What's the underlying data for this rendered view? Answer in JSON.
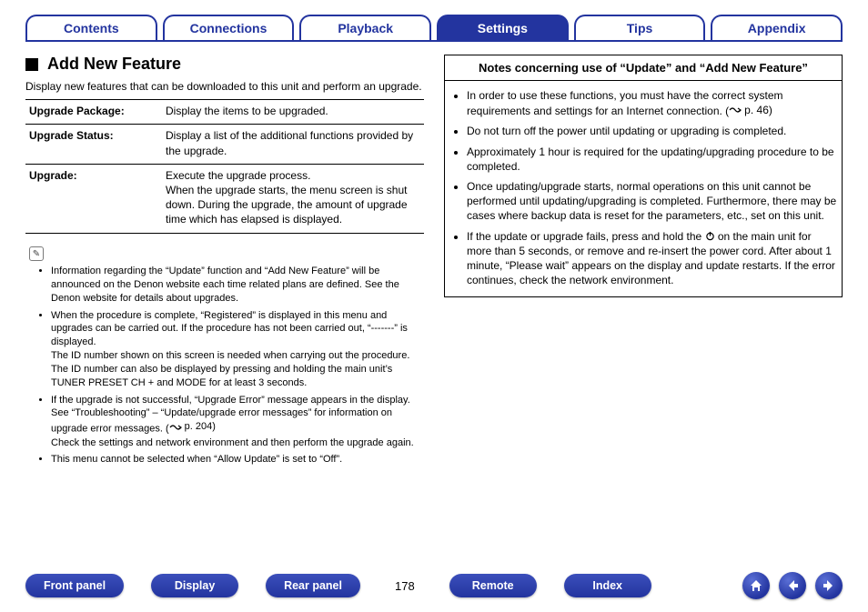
{
  "tabs": {
    "contents": "Contents",
    "connections": "Connections",
    "playback": "Playback",
    "settings": "Settings",
    "tips": "Tips",
    "appendix": "Appendix"
  },
  "left": {
    "title": "Add New Feature",
    "intro": "Display new features that can be downloaded to this unit and perform an upgrade.",
    "rows": {
      "upgrade_package_term": "Upgrade Package:",
      "upgrade_package_desc": "Display the items to be upgraded.",
      "upgrade_status_term": "Upgrade Status:",
      "upgrade_status_desc": "Display a list of the additional functions provided by the upgrade.",
      "upgrade_term": "Upgrade:",
      "upgrade_desc": "Execute the upgrade process.\nWhen the upgrade starts, the menu screen is shut down. During the upgrade, the amount of upgrade time which has elapsed is displayed."
    },
    "notes": {
      "n1": "Information regarding the “Update” function and “Add New Feature” will be announced on the Denon website each time related plans are defined. See the Denon website for details about upgrades.",
      "n2a": "When the procedure is complete, “Registered” is displayed in this menu and upgrades can be carried out. If the procedure has not been carried out, “-------” is displayed.",
      "n2b": "The ID number shown on this screen is needed when carrying out the procedure.",
      "n2c": "The ID number can also be displayed by pressing and holding the main unit’s TUNER PRESET CH + and MODE for at least 3 seconds.",
      "n3a": "If the upgrade is not successful, “Upgrade Error” message appears in the display. See “Troubleshooting” – “Update/upgrade error messages” for information on upgrade error messages. (",
      "n3b": " p. 204)",
      "n3c": "Check the settings and network environment and then perform the upgrade again.",
      "n4": "This menu cannot be selected when “Allow Update” is set to “Off”."
    }
  },
  "right": {
    "head": "Notes concerning use of “Update” and “Add New Feature”",
    "b1a": "In order to use these functions, you must have the correct system requirements and settings for an Internet connection.  (",
    "b1b": " p. 46)",
    "b2": "Do not turn off the power until updating or upgrading is completed.",
    "b3": "Approximately 1 hour is required for the updating/upgrading procedure to be completed.",
    "b4": "Once updating/upgrade starts, normal operations on this unit cannot be performed until updating/upgrading is completed. Furthermore, there may be cases where backup data is reset for the parameters, etc., set on this unit.",
    "b5a": "If the update or upgrade fails, press and hold the ",
    "b5b": " on the main unit for more than 5 seconds, or remove and re-insert the power cord. After about 1 minute, “Please wait” appears on the display and update restarts. If the error continues, check the network environment."
  },
  "footer": {
    "front_panel": "Front panel",
    "display": "Display",
    "rear_panel": "Rear panel",
    "page": "178",
    "remote": "Remote",
    "index": "Index"
  }
}
